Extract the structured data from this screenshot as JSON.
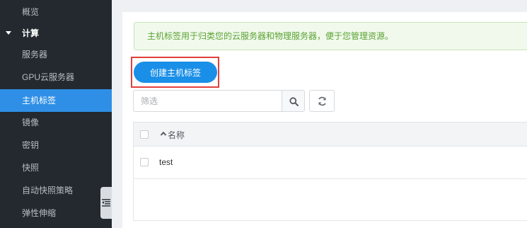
{
  "sidebar": {
    "items": [
      {
        "label": "概览"
      },
      {
        "label": "计算",
        "group": true
      },
      {
        "label": "服务器"
      },
      {
        "label": "GPU云服务器"
      },
      {
        "label": "主机标签",
        "active": true
      },
      {
        "label": "镜像"
      },
      {
        "label": "密钥"
      },
      {
        "label": "快照"
      },
      {
        "label": "自动快照策略"
      },
      {
        "label": "弹性伸缩"
      }
    ]
  },
  "notice": {
    "text": "主机标签用于归类您的云服务器和物理服务器，便于您管理资源。"
  },
  "toolbar": {
    "create_label": "创建主机标签",
    "filter_placeholder": "筛选"
  },
  "table": {
    "columns": [
      "名称"
    ],
    "rows": [
      {
        "name": "test"
      }
    ]
  },
  "colors": {
    "accent": "#1a8fe8",
    "sidebar_bg": "#23292f",
    "active_nav": "#2f8fe6",
    "notice_text": "#5aa333",
    "highlight": "#e0403c"
  },
  "icons": [
    "caret-down-icon",
    "collapse-sidebar-icon",
    "search-icon",
    "refresh-icon",
    "sort-up-icon"
  ]
}
